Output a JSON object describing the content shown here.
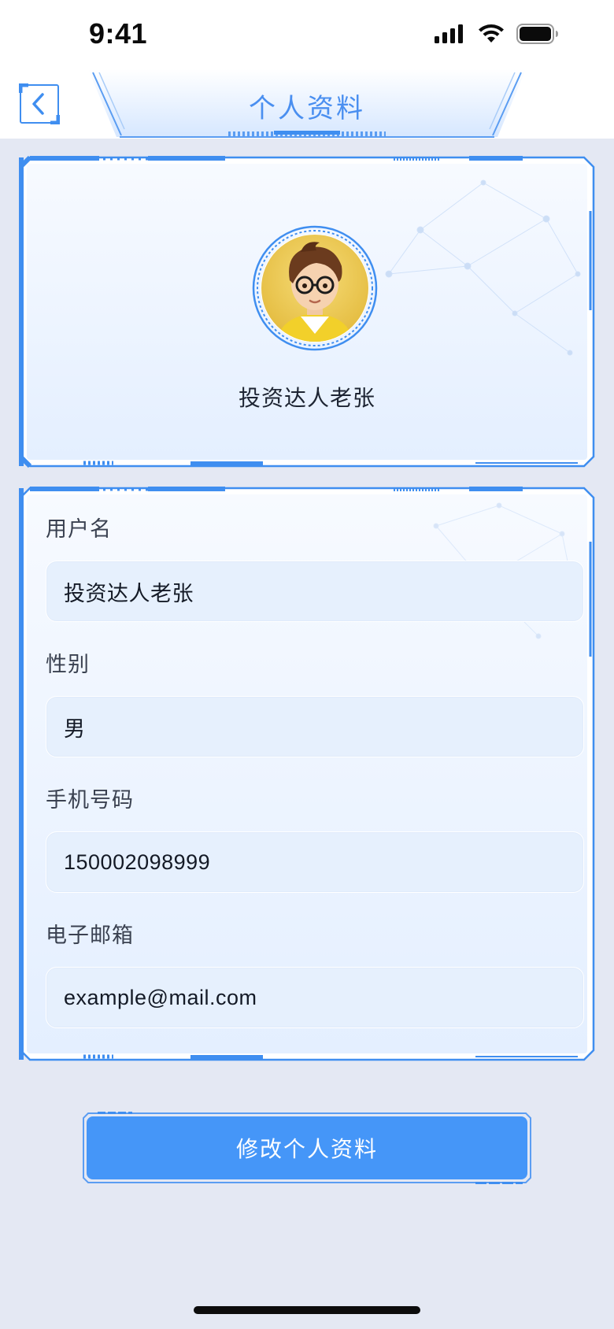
{
  "status_bar": {
    "time": "9:41"
  },
  "nav": {
    "title": "个人资料",
    "back_icon": "chevron-left-icon"
  },
  "profile": {
    "display_name": "投资达人老张",
    "avatar_icon": "avatar-cartoon-man-glasses"
  },
  "form": {
    "fields": [
      {
        "label": "用户名",
        "value": "投资达人老张"
      },
      {
        "label": "性别",
        "value": "男"
      },
      {
        "label": "手机号码",
        "value": "150002098999"
      },
      {
        "label": "电子邮箱",
        "value": "example@mail.com"
      }
    ]
  },
  "actions": {
    "edit_label": "修改个人资料"
  },
  "colors": {
    "accent": "#4596f8",
    "frame": "#3f8ef0",
    "page_bg": "#e4e8f3",
    "input_bg": "#e6f0fd"
  }
}
